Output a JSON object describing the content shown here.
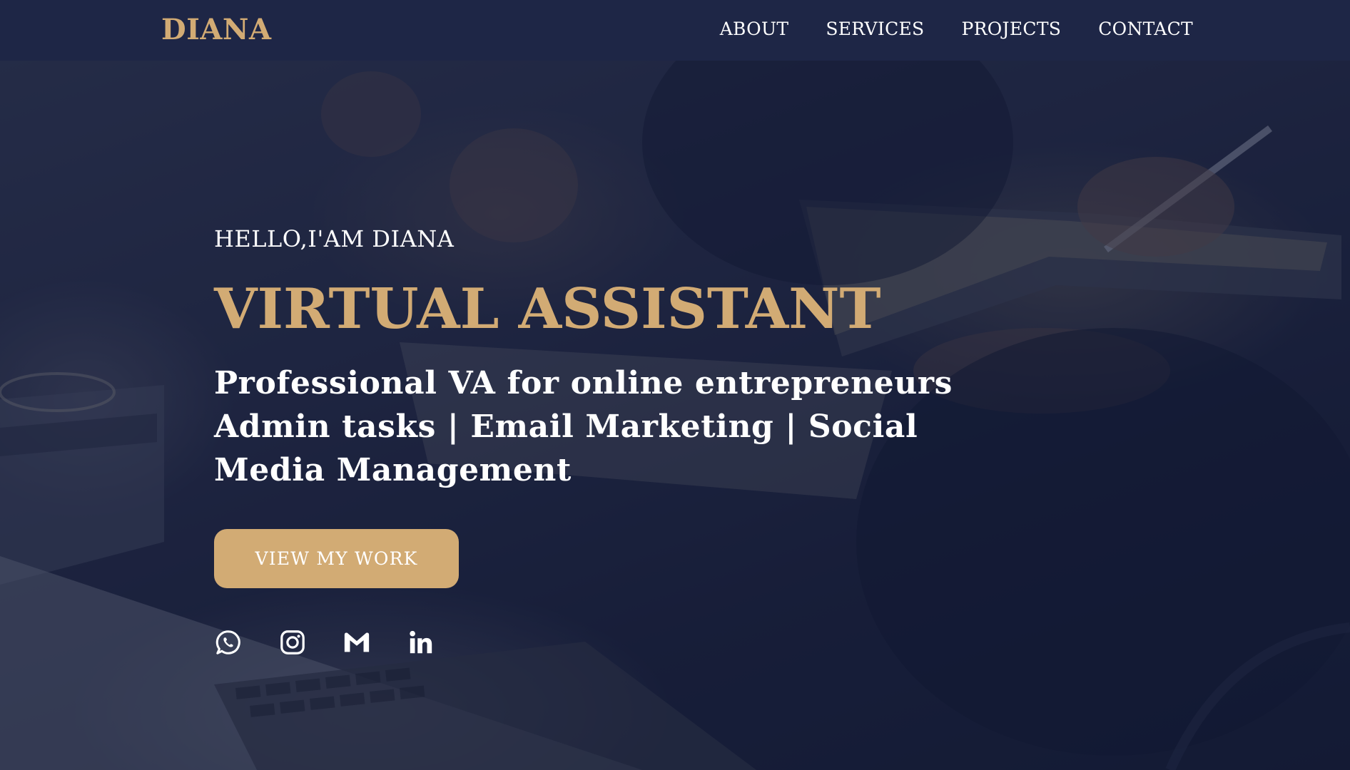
{
  "brand": {
    "name": "DIANA"
  },
  "nav": {
    "items": [
      {
        "label": "ABOUT"
      },
      {
        "label": "SERVICES"
      },
      {
        "label": "PROJECTS"
      },
      {
        "label": "CONTACT"
      }
    ]
  },
  "hero": {
    "greeting": "HELLO,I'AM DIANA",
    "title": "VIRTUAL ASSISTANT",
    "tagline_line1": "Professional VA for online entrepreneurs",
    "tagline_line2": "Admin tasks | Email Marketing | Social Media Management",
    "cta_label": "VIEW MY WORK",
    "socials": [
      {
        "icon": "whatsapp-icon"
      },
      {
        "icon": "instagram-icon"
      },
      {
        "icon": "gmail-icon"
      },
      {
        "icon": "linkedin-icon"
      }
    ]
  },
  "colors": {
    "navbar": "#1e2646",
    "accent": "#d2ab74",
    "text": "#ffffff"
  }
}
